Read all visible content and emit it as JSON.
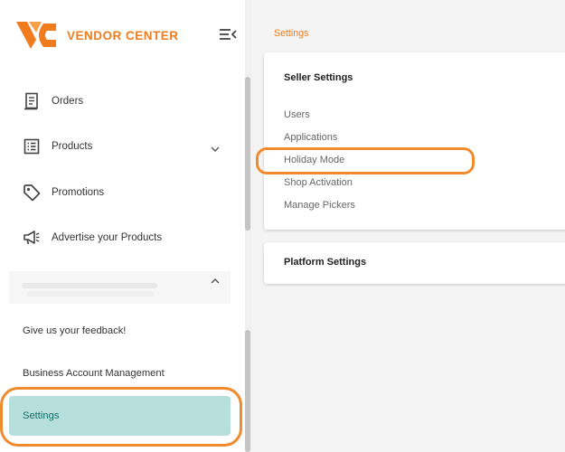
{
  "brand": {
    "name": "VENDOR CENTER",
    "color": "#f07c1e"
  },
  "sidebar": {
    "items": [
      {
        "label": "Orders",
        "icon": "receipt-icon"
      },
      {
        "label": "Products",
        "icon": "list-icon",
        "expandable": true
      },
      {
        "label": "Promotions",
        "icon": "tag-icon"
      },
      {
        "label": "Advertise your Products",
        "icon": "megaphone-icon"
      }
    ],
    "collapsed_group": {
      "expanded": true
    },
    "feedback": "Give us your feedback!",
    "business": "Business Account Management",
    "settings": "Settings",
    "active_color": "#b7e0dc"
  },
  "main": {
    "breadcrumb": "Settings",
    "seller_card": {
      "title": "Seller Settings",
      "links": [
        "Users",
        "Applications",
        "Holiday Mode",
        "Shop Activation",
        "Manage Pickers"
      ]
    },
    "platform_card": {
      "title": "Platform Settings"
    }
  },
  "annotation_color": "#f08a2c"
}
